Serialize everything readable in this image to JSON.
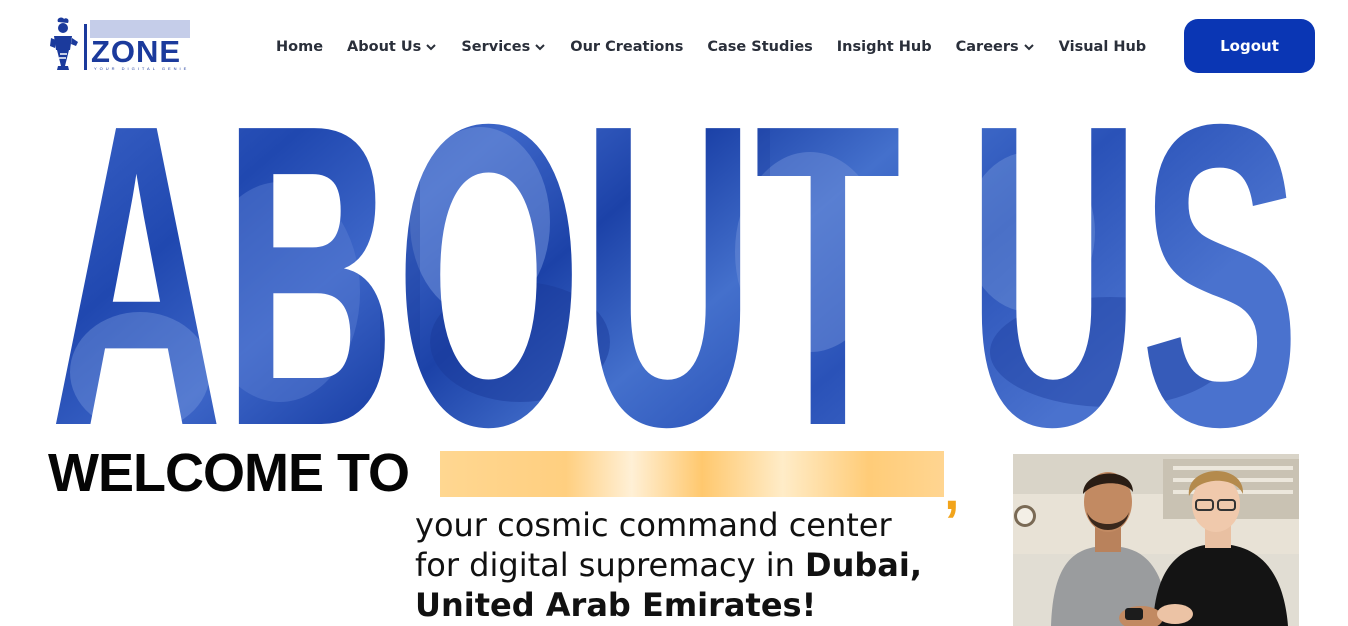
{
  "header": {
    "logo": {
      "text": "ZONE",
      "tagline": "YOUR DIGITAL GENIE"
    },
    "nav": [
      {
        "label": "Home",
        "dropdown": false
      },
      {
        "label": "About Us",
        "dropdown": true
      },
      {
        "label": "Services",
        "dropdown": true
      },
      {
        "label": "Our Creations",
        "dropdown": false
      },
      {
        "label": "Case Studies",
        "dropdown": false
      },
      {
        "label": "Insight Hub",
        "dropdown": false
      },
      {
        "label": "Careers",
        "dropdown": true
      },
      {
        "label": "Visual Hub",
        "dropdown": false
      }
    ],
    "logout_label": "Logout"
  },
  "hero": {
    "title": "ABOUT US"
  },
  "welcome": {
    "prefix": "WELCOME TO",
    "comma": ",",
    "line1": "your cosmic command center",
    "line2_plain": "for digital supremacy in",
    "line2_bold": "Dubai,",
    "line3_bold": "United Arab Emirates!"
  },
  "colors": {
    "brand_blue": "#0a36b4",
    "hero_blue": "#3a63c4",
    "accent_orange": "#f2a41b"
  }
}
